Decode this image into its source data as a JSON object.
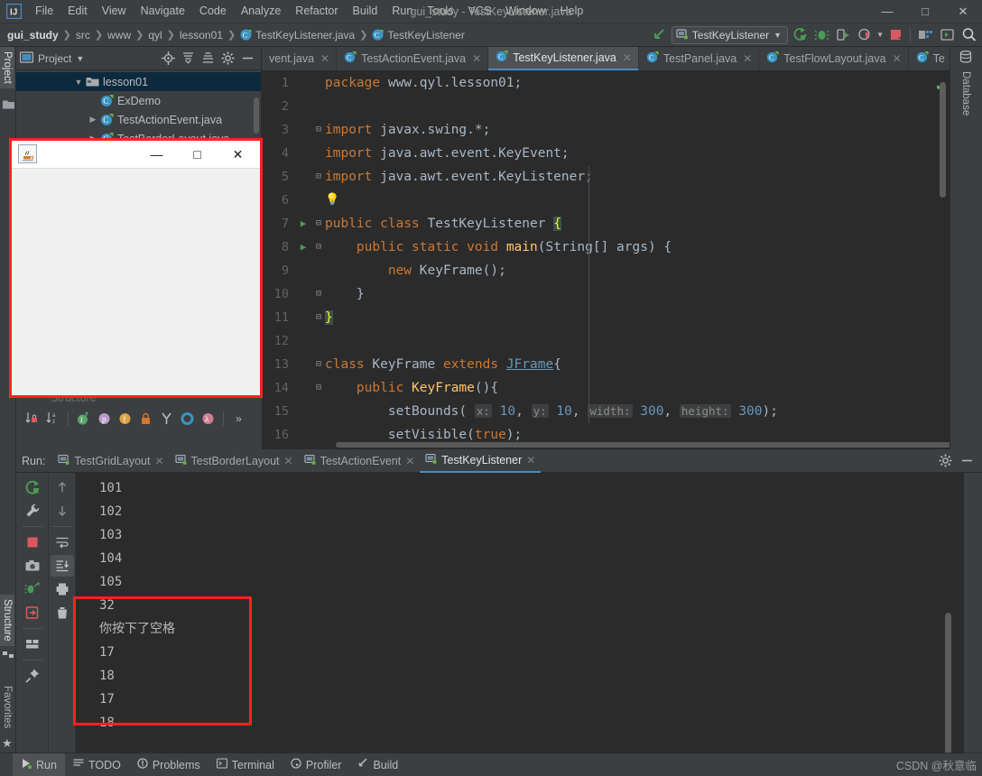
{
  "window": {
    "title": "gui_study - TestKeyListener.java",
    "minimize": "—",
    "maximize": "□",
    "close": "✕"
  },
  "menubar": {
    "items": [
      "File",
      "Edit",
      "View",
      "Navigate",
      "Code",
      "Analyze",
      "Refactor",
      "Build",
      "Run",
      "Tools",
      "VCS",
      "Window",
      "Help"
    ]
  },
  "navbar": {
    "breadcrumb": [
      "gui_study",
      "src",
      "www",
      "qyl",
      "lesson01",
      "TestKeyListener.java",
      "TestKeyListener"
    ],
    "run_config": "TestKeyListener",
    "icons": [
      "back-arrow-icon",
      "run-icon",
      "debug-icon",
      "run-with-coverage-icon",
      "profile-icon",
      "stop-icon",
      "build-project-icon",
      "select-opened-file-icon",
      "search-everywhere-icon"
    ]
  },
  "left_strip": {
    "tabs": [
      "Project"
    ],
    "lower_tabs": [
      "Structure",
      "Favorites"
    ]
  },
  "right_strip": {
    "tabs": [
      "Database"
    ]
  },
  "project_panel": {
    "title": "Project",
    "header_icons": [
      "locate-icon",
      "expand-all-icon",
      "collapse-all-icon",
      "settings-icon",
      "hide-icon"
    ],
    "tree": [
      {
        "label": "lesson01",
        "icon": "folder-icon",
        "indent": 2,
        "arrow": "▾",
        "selected": true
      },
      {
        "label": "ExDemo",
        "icon": "java-class-icon",
        "indent": 3,
        "arrow": "",
        "selected": false
      },
      {
        "label": "TestActionEvent.java",
        "icon": "java-class-icon",
        "indent": 3,
        "arrow": "›",
        "selected": false
      },
      {
        "label": "TestBorderLayout.java",
        "icon": "java-class-icon",
        "indent": 3,
        "arrow": "›",
        "selected": false
      }
    ]
  },
  "editor_tabs": [
    {
      "label": "vent.java",
      "active": false,
      "partial": true
    },
    {
      "label": "TestActionEvent.java",
      "active": false
    },
    {
      "label": "TestKeyListener.java",
      "active": true
    },
    {
      "label": "TestPanel.java",
      "active": false
    },
    {
      "label": "TestFlowLayout.java",
      "active": false
    },
    {
      "label": "Te",
      "active": false,
      "partial": true
    }
  ],
  "editor": {
    "lines": [
      {
        "n": "1",
        "mark": "",
        "fold": "",
        "indent": 0,
        "text": "package www.qyl.lesson01;",
        "type": "package"
      },
      {
        "n": "2",
        "mark": "",
        "fold": "",
        "indent": 0,
        "text": "",
        "type": "blank"
      },
      {
        "n": "3",
        "mark": "",
        "fold": "⊟",
        "indent": 0,
        "text": "import javax.swing.*;",
        "type": "import"
      },
      {
        "n": "4",
        "mark": "",
        "fold": "",
        "indent": 0,
        "text": "import java.awt.event.KeyEvent;",
        "type": "import"
      },
      {
        "n": "5",
        "mark": "",
        "fold": "⊟",
        "indent": 0,
        "text": "import java.awt.event.KeyListener;",
        "type": "import"
      },
      {
        "n": "6",
        "mark": "",
        "fold": "",
        "indent": 0,
        "text": "",
        "type": "bulb"
      },
      {
        "n": "7",
        "mark": "▶",
        "fold": "⊟",
        "indent": 0,
        "text": "public class TestKeyListener {",
        "type": "classdecl"
      },
      {
        "n": "8",
        "mark": "▶",
        "fold": "⊟",
        "indent": 1,
        "text": "public static void main(String[] args) {",
        "type": "method"
      },
      {
        "n": "9",
        "mark": "",
        "fold": "",
        "indent": 2,
        "text": "new KeyFrame();",
        "type": "newcall"
      },
      {
        "n": "10",
        "mark": "",
        "fold": "⊟",
        "indent": 1,
        "text": "}",
        "type": "plain"
      },
      {
        "n": "11",
        "mark": "",
        "fold": "⊟",
        "indent": 0,
        "text": "}",
        "type": "brace-hl"
      },
      {
        "n": "12",
        "mark": "",
        "fold": "",
        "indent": 0,
        "text": "",
        "type": "blank"
      },
      {
        "n": "13",
        "mark": "",
        "fold": "⊟",
        "indent": 0,
        "text": "class KeyFrame extends JFrame{",
        "type": "keyframe"
      },
      {
        "n": "14",
        "mark": "",
        "fold": "⊟",
        "indent": 1,
        "text": "public KeyFrame(){",
        "type": "ctor"
      },
      {
        "n": "15",
        "mark": "",
        "fold": "",
        "indent": 2,
        "text": "setBounds( x: 10, y: 10, width: 300, height: 300);",
        "type": "setbounds"
      },
      {
        "n": "16",
        "mark": "",
        "fold": "",
        "indent": 2,
        "text": "setVisible(true);",
        "type": "setvisible"
      }
    ],
    "inlay_hints": [
      "x:",
      "y:",
      "width:",
      "height:"
    ],
    "inlay_values": [
      "10",
      "10",
      "300",
      "300"
    ],
    "status_check": "✔"
  },
  "structure_bar": {
    "title": "Structure",
    "icons": [
      "sort-by-visibility-icon",
      "sort-alphabetically-icon",
      "show-inherited-icon",
      "show-properties-icon",
      "show-fields-icon",
      "show-non-public-icon",
      "show-anonymous-icon",
      "show-interfaces-icon",
      "show-lambdas-icon",
      "more-icon"
    ]
  },
  "run_panel": {
    "label": "Run:",
    "tabs": [
      {
        "label": "TestGridLayout",
        "active": false
      },
      {
        "label": "TestBorderLayout",
        "active": false
      },
      {
        "label": "TestActionEvent",
        "active": false
      },
      {
        "label": "TestKeyListener",
        "active": true
      }
    ],
    "right_icons": [
      "settings-icon",
      "hide-icon"
    ],
    "side_icons": [
      "rerun-icon",
      "wrench-icon",
      "stop-icon",
      "screenshot-icon",
      "dump-threads-icon",
      "exit-icon",
      "layout-icon",
      "pin-icon"
    ],
    "side_icons2": [
      "up-arrow-icon",
      "down-arrow-icon",
      "soft-wrap-icon",
      "scroll-to-end-icon",
      "print-icon",
      "clear-all-icon"
    ],
    "console_lines": [
      "101",
      "102",
      "103",
      "104",
      "105",
      "32",
      "你按下了空格",
      "17",
      "18",
      "17",
      "18"
    ],
    "highlighted_from": 6
  },
  "status_bar": {
    "items": [
      {
        "label": "Run",
        "icon": "run-icon",
        "active": true
      },
      {
        "label": "TODO",
        "icon": "todo-icon",
        "active": false
      },
      {
        "label": "Problems",
        "icon": "problems-icon",
        "active": false
      },
      {
        "label": "Terminal",
        "icon": "terminal-icon",
        "active": false
      },
      {
        "label": "Profiler",
        "icon": "profiler-icon",
        "active": false
      },
      {
        "label": "Build",
        "icon": "build-icon",
        "active": false
      }
    ],
    "watermark": "CSDN @秋意临"
  },
  "java_window": {
    "icon": "java-coffee-icon",
    "minimize": "—",
    "maximize": "□",
    "close": "✕"
  },
  "colors": {
    "accent": "#4a88c7",
    "annotation_red": "#ff2222",
    "editor_bg": "#2b2b2b",
    "panel_bg": "#3c3f41",
    "keyword": "#cc7832",
    "number": "#6897bb",
    "string": "#6a8759",
    "method": "#ffc66d",
    "selection": "#0d293e",
    "run_green": "#499c54"
  }
}
